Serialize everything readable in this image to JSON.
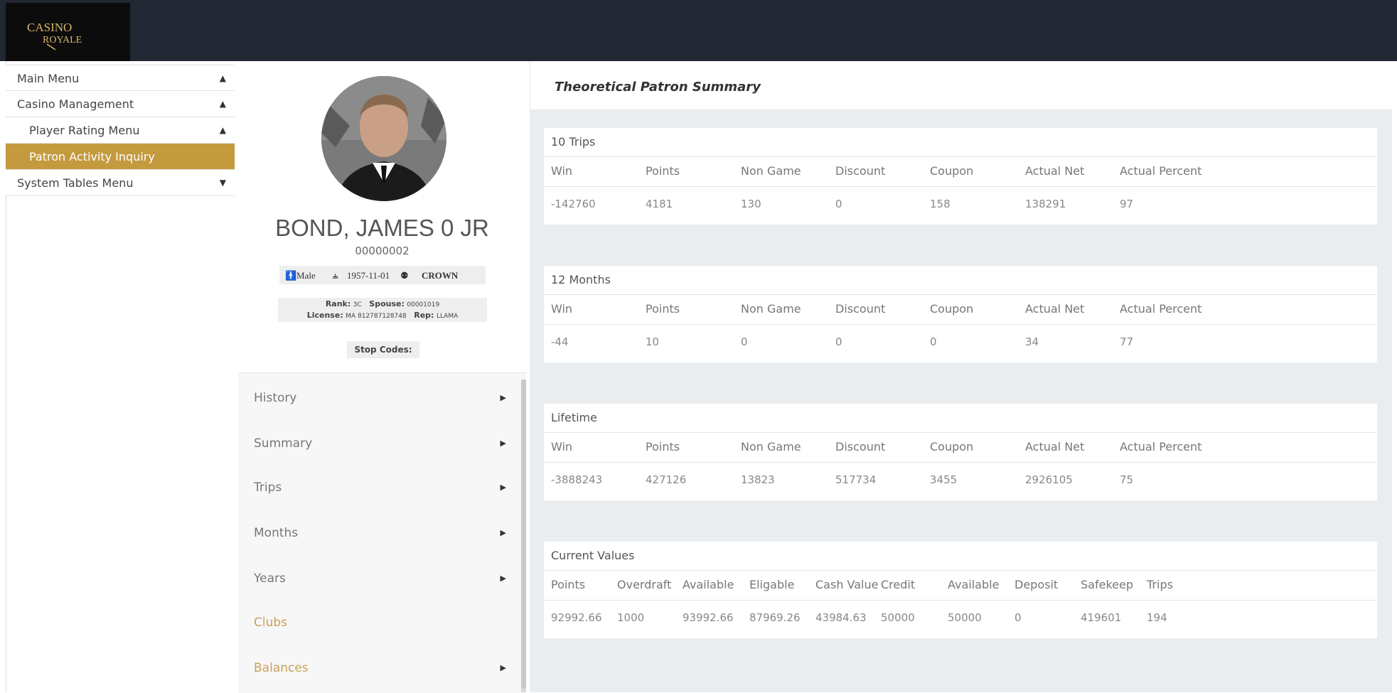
{
  "logo": {
    "line1": "CASINO",
    "line2": "ROYALE"
  },
  "left_menu": [
    {
      "label": "Main Menu",
      "arrow": "▲"
    },
    {
      "label": "Casino Management",
      "arrow": "▲"
    },
    {
      "label": "Player Rating Menu",
      "arrow": "▲"
    },
    {
      "label": "Patron Activity Inquiry",
      "arrow": ""
    },
    {
      "label": "System Tables Menu",
      "arrow": "▼"
    }
  ],
  "patron": {
    "name": "BOND, JAMES 0 JR",
    "id": "00000002",
    "gender": "Male",
    "birthdate": "1957-11-01",
    "club": "CROWN",
    "rank_label": "Rank:",
    "rank": "3C",
    "spouse_label": "Spouse:",
    "spouse": "00001019",
    "license_label": "License:",
    "license": "MA 812787128748",
    "rep_label": "Rep:",
    "rep": "LLAMA",
    "stop_codes_label": "Stop Codes:"
  },
  "subnav": [
    {
      "label": "History",
      "arrow": "▶"
    },
    {
      "label": "Summary",
      "arrow": "▶"
    },
    {
      "label": "Trips",
      "arrow": "▶"
    },
    {
      "label": "Months",
      "arrow": "▶"
    },
    {
      "label": "Years",
      "arrow": "▶"
    },
    {
      "label": "Clubs",
      "arrow": ""
    },
    {
      "label": "Balances",
      "arrow": "▶"
    }
  ],
  "page_title": "Theoretical Patron Summary",
  "summary_columns": [
    "Win",
    "Points",
    "Non Game",
    "Discount",
    "Coupon",
    "Actual Net",
    "Actual Percent"
  ],
  "sections": [
    {
      "title": "10 Trips",
      "values": [
        "-142760",
        "4181",
        "130",
        "0",
        "158",
        "138291",
        "97"
      ]
    },
    {
      "title": "12 Months",
      "values": [
        "-44",
        "10",
        "0",
        "0",
        "0",
        "34",
        "77"
      ]
    },
    {
      "title": "Lifetime",
      "values": [
        "-3888243",
        "427126",
        "13823",
        "517734",
        "3455",
        "2926105",
        "75"
      ]
    }
  ],
  "current_values": {
    "title": "Current Values",
    "columns": [
      "Points",
      "Overdraft",
      "Available",
      "Eligable",
      "Cash Value",
      "Credit",
      "Available",
      "Deposit",
      "Safekeep",
      "Trips"
    ],
    "values": [
      "92992.66",
      "1000",
      "93992.66",
      "87969.26",
      "43984.63",
      "50000",
      "50000",
      "0",
      "419601",
      "194"
    ]
  },
  "colors": {
    "topbar": "#212733",
    "active_menu": "#c39a3e",
    "gold_text": "#c9a15a",
    "content_bg": "#eaedf0"
  }
}
